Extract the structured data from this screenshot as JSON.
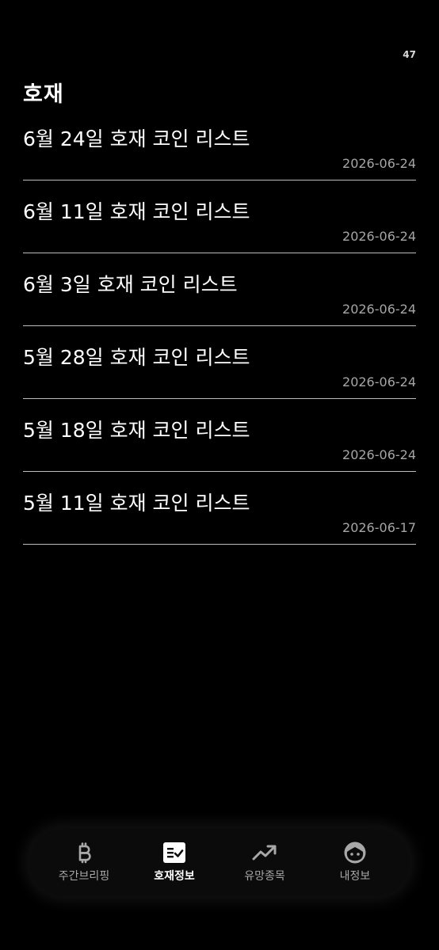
{
  "status": {
    "count": "47"
  },
  "page": {
    "title": "호재"
  },
  "items": [
    {
      "title": "6월 24일 호재 코인 리스트",
      "date": "2026-06-24"
    },
    {
      "title": "6월 11일 호재 코인 리스트",
      "date": "2026-06-24"
    },
    {
      "title": "6월 3일 호재 코인 리스트",
      "date": "2026-06-24"
    },
    {
      "title": "5월 28일 호재 코인 리스트",
      "date": "2026-06-24"
    },
    {
      "title": "5월 18일 호재 코인 리스트",
      "date": "2026-06-24"
    },
    {
      "title": "5월 11일 호재 코인 리스트",
      "date": "2026-06-17"
    }
  ],
  "nav": {
    "active": "호재정보",
    "tabs": [
      {
        "label": "주간브리핑",
        "icon": "bitcoin-icon"
      },
      {
        "label": "호재정보",
        "icon": "checklist-icon"
      },
      {
        "label": "유망종목",
        "icon": "trending-up-icon"
      },
      {
        "label": "내정보",
        "icon": "face-icon"
      }
    ]
  },
  "colors": {
    "background": "#000000",
    "text": "#ffffff",
    "date": "#a6a6a6",
    "divider": "#bdbdbd",
    "nav_inactive": "#a8a8a8"
  }
}
